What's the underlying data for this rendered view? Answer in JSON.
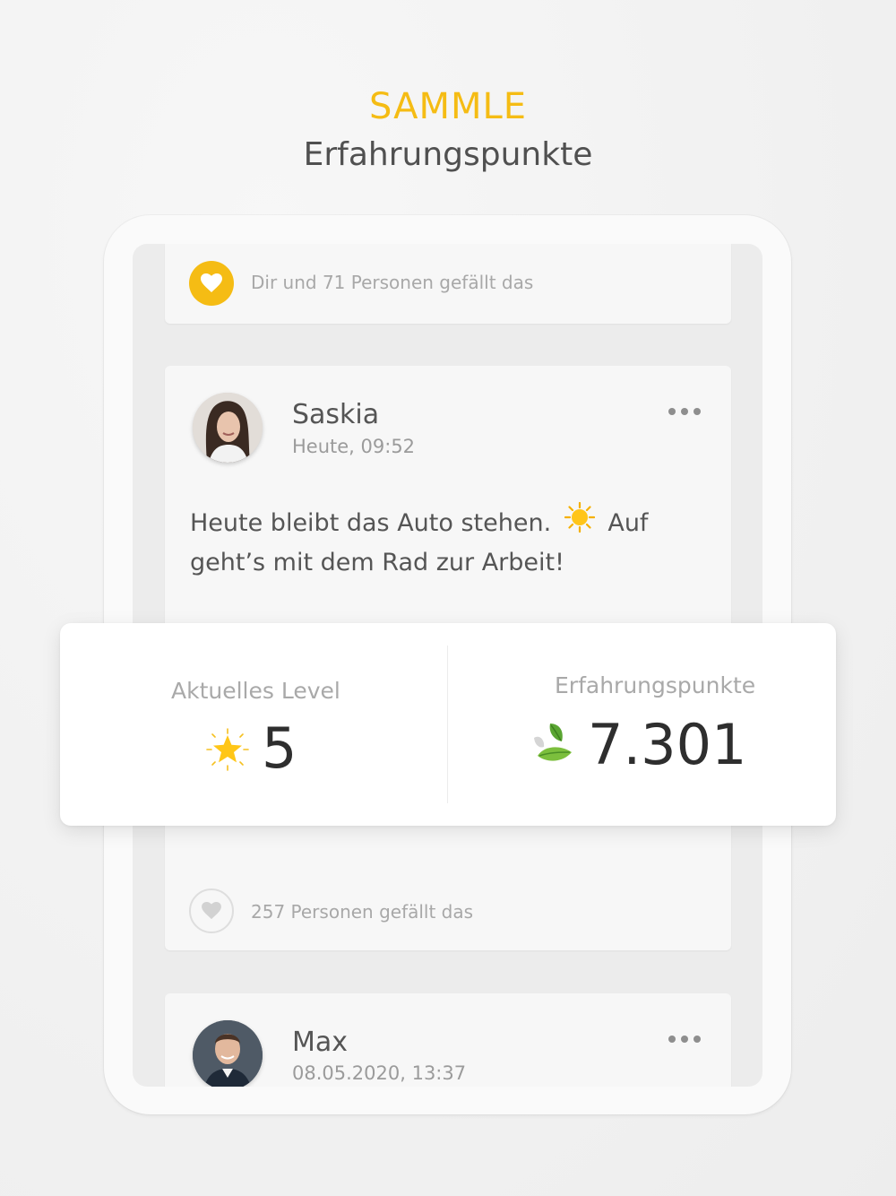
{
  "header": {
    "kicker": "SAMMLE",
    "title": "Erfahrungspunkte"
  },
  "colors": {
    "accent": "#f5bc14",
    "text": "#555555",
    "muted": "#a8a8a8"
  },
  "feed": {
    "top_likes": {
      "icon": "heart-icon",
      "text": "Dir und 71 Personen gefällt das"
    },
    "posts": [
      {
        "author": "Saskia",
        "time": "Heute, 09:52",
        "text_before": "Heute bleibt das Auto stehen.",
        "text_emoji": "sun-icon",
        "text_after": "Auf geht’s mit dem Rad zur Arbeit!",
        "likes": "257 Personen gefällt das"
      },
      {
        "author": "Max",
        "time": "08.05.2020, 13:37"
      }
    ]
  },
  "stats": {
    "level_label": "Aktuelles Level",
    "level_value": "5",
    "level_icon": "star-icon",
    "points_label": "Erfahrungspunkte",
    "points_value": "7.301",
    "points_icon": "leaf-icon"
  }
}
